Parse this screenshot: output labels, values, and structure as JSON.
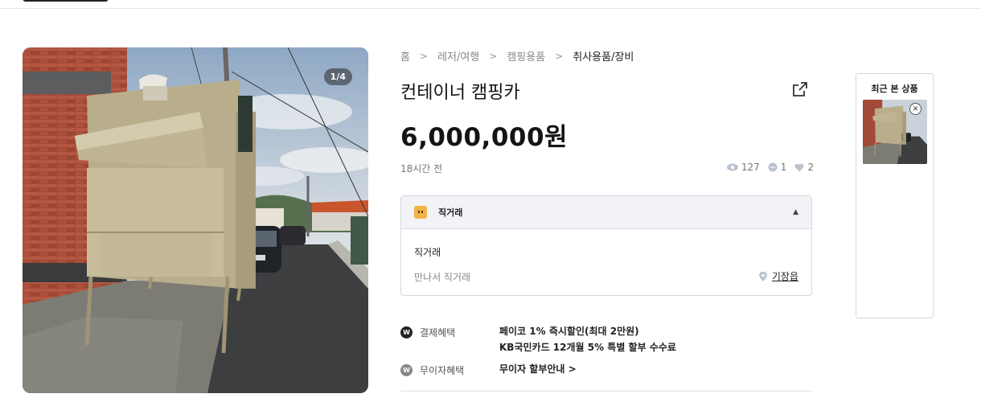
{
  "gallery": {
    "counter": "1/4"
  },
  "breadcrumb": [
    {
      "label": "홈"
    },
    {
      "label": "레저/여행"
    },
    {
      "label": "캠핑용품"
    },
    {
      "label": "취사용품/장비"
    }
  ],
  "product": {
    "title": "컨테이너 캠핑카",
    "price": "6,000,000원",
    "time_ago": "18시간 전",
    "views": "127",
    "chats": "1",
    "likes": "2"
  },
  "deal": {
    "header": "직거래",
    "type": "직거래",
    "method": "만나서 직거래",
    "location": "기장읍"
  },
  "benefits": [
    {
      "name": "결제혜택",
      "lines": [
        "페이코 1% 즉시할인(최대 2만원)",
        "KB국민카드 12개월 5% 특별 할부 수수료"
      ],
      "icon_color": "#222222"
    },
    {
      "name": "무이자혜택",
      "lines": [
        "무이자 할부안내 >"
      ],
      "icon_color": "#888888"
    }
  ],
  "recent": {
    "title": "최근 본 상품"
  }
}
